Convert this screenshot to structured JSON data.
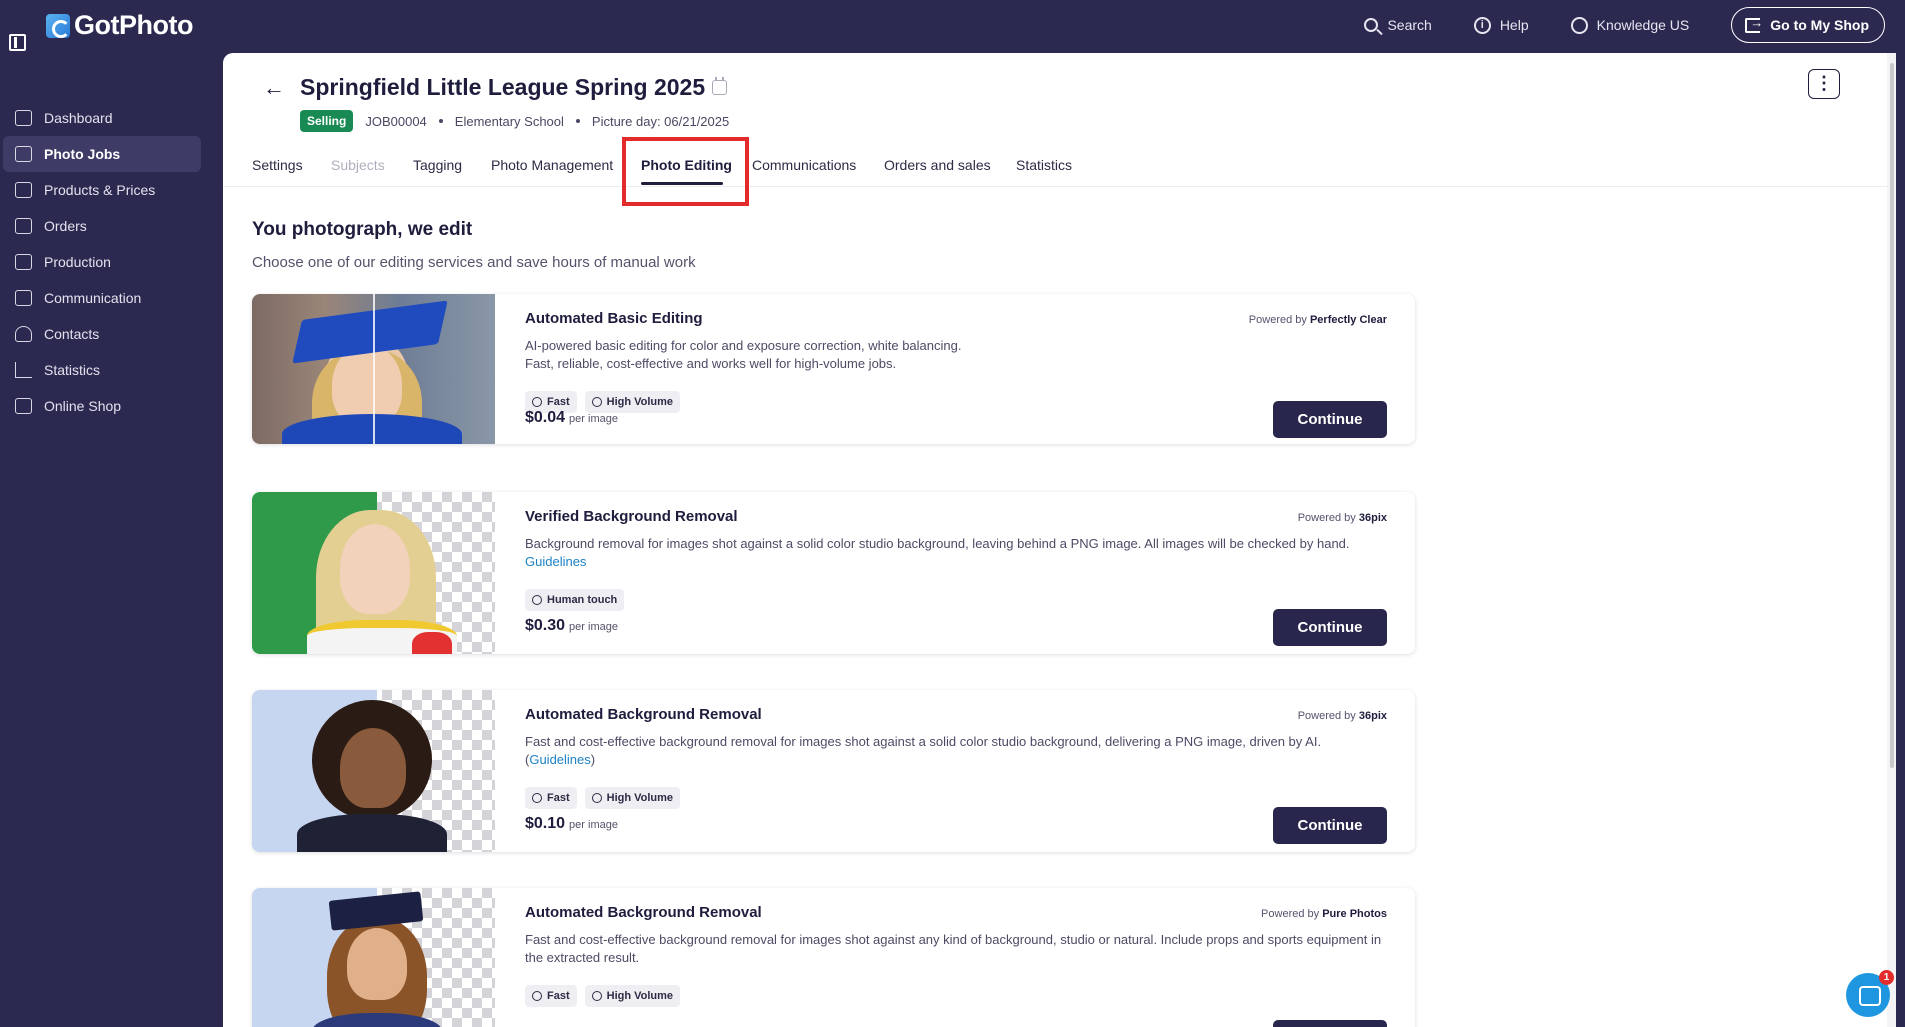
{
  "app": {
    "brand": "GotPhoto",
    "accent": "#2b2950"
  },
  "topbar": {
    "search_label": "Search",
    "help_label": "Help",
    "account_label": "Knowledge US",
    "shop_button_label": "Go to My Shop"
  },
  "sidebar": {
    "items": [
      {
        "label": "Dashboard",
        "icon": "home-icon"
      },
      {
        "label": "Photo Jobs",
        "icon": "image-icon",
        "active": true
      },
      {
        "label": "Products & Prices",
        "icon": "cart-icon"
      },
      {
        "label": "Orders",
        "icon": "box-icon"
      },
      {
        "label": "Production",
        "icon": "printer-icon"
      },
      {
        "label": "Communication",
        "icon": "chat-icon"
      },
      {
        "label": "Contacts",
        "icon": "user-icon"
      },
      {
        "label": "Statistics",
        "icon": "chart-icon"
      },
      {
        "label": "Online Shop",
        "icon": "store-icon"
      }
    ]
  },
  "job": {
    "title": "Springfield Little League Spring 2025",
    "status": "Selling",
    "status_color": "#1a8a54",
    "job_id": "JOB00004",
    "school_type": "Elementary School",
    "picture_day": "Picture day: 06/21/2025"
  },
  "tabs": [
    {
      "label": "Settings"
    },
    {
      "label": "Subjects",
      "disabled": true
    },
    {
      "label": "Tagging"
    },
    {
      "label": "Photo Management"
    },
    {
      "label": "Photo Editing",
      "active": true
    },
    {
      "label": "Communications"
    },
    {
      "label": "Orders and sales"
    },
    {
      "label": "Statistics"
    }
  ],
  "section": {
    "title": "You photograph, we edit",
    "subtitle": "Choose one of our editing services and save hours of manual work"
  },
  "services": [
    {
      "title": "Automated Basic Editing",
      "powered_prefix": "Powered by",
      "provider": "Perfectly Clear",
      "description": "AI-powered basic editing for color and exposure correction, white balancing.",
      "description_2": "Fast, reliable, cost-effective and works well for high-volume jobs.",
      "tags": [
        "Fast",
        "High Volume"
      ],
      "price": "$0.04",
      "price_unit": "per image",
      "button": "Continue"
    },
    {
      "title": "Verified Background Removal",
      "powered_prefix": "Powered by",
      "provider": "36pix",
      "description": "Background removal for images shot against a solid color studio background, leaving behind a PNG image. All images will be checked by hand.",
      "link": "Guidelines",
      "tags": [
        "Human touch"
      ],
      "price": "$0.30",
      "price_unit": "per image",
      "button": "Continue"
    },
    {
      "title": "Automated Background Removal",
      "powered_prefix": "Powered by",
      "provider": "36pix",
      "description": "Fast and cost-effective background removal for images shot against a solid color studio background, delivering a PNG image, driven by AI.",
      "link_open": "(",
      "link": "Guidelines",
      "link_close": ")",
      "tags": [
        "Fast",
        "High Volume"
      ],
      "price": "$0.10",
      "price_unit": "per image",
      "button": "Continue"
    },
    {
      "title": "Automated Background Removal",
      "powered_prefix": "Powered by",
      "provider": "Pure Photos",
      "description": "Fast and cost-effective background removal for images shot against any kind of background, studio or natural. Include props and sports equipment in the extracted result.",
      "tags": [
        "Fast",
        "High Volume"
      ]
    }
  ],
  "chat": {
    "badge": "1"
  }
}
